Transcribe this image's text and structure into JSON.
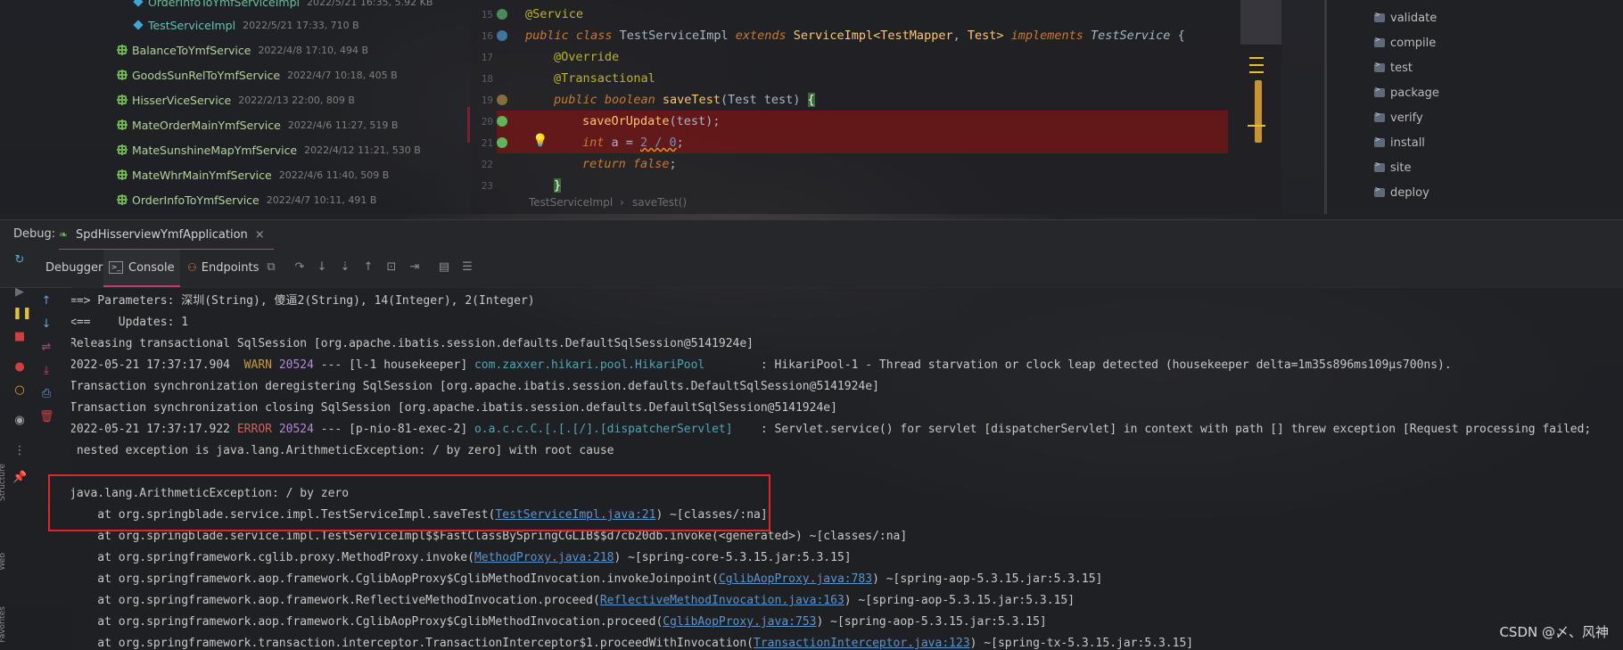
{
  "tree": {
    "rows": [
      {
        "name": "OrderInfoToYmfServiceImpl",
        "meta": "2022/5/21 16:35, 5.92 KB",
        "icon": "class-icon"
      },
      {
        "name": "TestServiceImpl",
        "meta": "2022/5/21 17:33, 710 B",
        "icon": "class-icon"
      },
      {
        "name": "BalanceToYmfService",
        "meta": "2022/4/8 17:10, 494 B",
        "icon": "interface-icon"
      },
      {
        "name": "GoodsSunRelToYmfService",
        "meta": "2022/4/7 10:18, 405 B",
        "icon": "interface-icon"
      },
      {
        "name": "HisserViceService",
        "meta": "2022/2/13 22:00, 809 B",
        "icon": "interface-icon"
      },
      {
        "name": "MateOrderMainYmfService",
        "meta": "2022/4/6 11:27, 519 B",
        "icon": "interface-icon"
      },
      {
        "name": "MateSunshineMapYmfService",
        "meta": "2022/4/12 11:21, 530 B",
        "icon": "interface-icon"
      },
      {
        "name": "MateWhrMainYmfService",
        "meta": "2022/4/6 11:40, 509 B",
        "icon": "interface-icon"
      },
      {
        "name": "OrderInfoToYmfService",
        "meta": "2022/4/7 10:11, 491 B",
        "icon": "interface-icon"
      }
    ]
  },
  "editor": {
    "line_numbers": [
      "15",
      "16",
      "17",
      "18",
      "19",
      "20",
      "21",
      "22",
      "23"
    ],
    "lines": {
      "l15_ann": "@Service",
      "l16_kw1": "public class ",
      "l16_cls": "TestServiceImpl ",
      "l16_kw2": "extends ",
      "l16_sup": "ServiceImpl<",
      "l16_t1": "TestMapper",
      "l16_sep": ", ",
      "l16_t2": "Test",
      "l16_close": "> ",
      "l16_kw3": "implements ",
      "l16_ifc": "TestService",
      "l16_brace": " {",
      "l17": "@Override",
      "l18": "@Transactional",
      "l19_kw": "public boolean ",
      "l19_fn": "saveTest",
      "l19_args": "(Test test) ",
      "l19_brace": "{",
      "l20_fn": "saveOrUpdate",
      "l20_rest": "(test);",
      "l21_kw": "int ",
      "l21_a": "a = ",
      "l21_expr": "2 / 0",
      "l21_end": ";",
      "l22_kw": "return false",
      "l22_end": ";",
      "l23": "}"
    },
    "breadcrumb": [
      "TestServiceImpl",
      "›",
      "saveTest()"
    ]
  },
  "maven": {
    "items": [
      "validate",
      "compile",
      "test",
      "package",
      "verify",
      "install",
      "site",
      "deploy"
    ]
  },
  "debug": {
    "label": "Debug:",
    "session_tab": "SpdHisserviewYmfApplication",
    "close": "×",
    "tabs": [
      "Debugger",
      "Console",
      "Endpoints"
    ]
  },
  "console": {
    "l1": "==> Parameters: 深圳(String), 傻逼2(String), 14(Integer), 2(Integer)",
    "l2": "<==    Updates: 1",
    "l3": "Releasing transactional SqlSession [org.apache.ibatis.session.defaults.DefaultSqlSession@5141924e]",
    "l4_ts": "2022-05-21 17:37:17.904  ",
    "l4_lvl": "WARN ",
    "l4_pid": "20524",
    "l4_mid": " --- [l-1 housekeeper] ",
    "l4_logger": "com.zaxxer.hikari.pool.HikariPool       ",
    "l4_msg": " : HikariPool-1 - Thread starvation or clock leap detected (housekeeper delta=1m35s896ms109µs700ns).",
    "l5": "Transaction synchronization deregistering SqlSession [org.apache.ibatis.session.defaults.DefaultSqlSession@5141924e]",
    "l6": "Transaction synchronization closing SqlSession [org.apache.ibatis.session.defaults.DefaultSqlSession@5141924e]",
    "l7_ts": "2022-05-21 17:37:17.922 ",
    "l7_lvl": "ERROR ",
    "l7_pid": "20524",
    "l7_mid": " --- [p-nio-81-exec-2] ",
    "l7_logger": "o.a.c.c.C.[.[.[/].[dispatcherServlet]   ",
    "l7_msg": " : Servlet.service() for servlet [dispatcherServlet] in context with path [] threw exception [Request processing failed;",
    "l8": " nested exception is java.lang.ArithmeticException: / by zero] with root cause",
    "l10": "java.lang.ArithmeticException: / by zero",
    "l11_pre": "    at org.springblade.service.impl.TestServiceImpl.saveTest(",
    "l11_link": "TestServiceImpl.java:21",
    "l11_post": ") ~[classes/:na]",
    "l12": "    at org.springblade.service.impl.TestServiceImpl$$FastClassBySpringCGLIB$$d7cb20db.invoke(<generated>) ~[classes/:na]",
    "l13_pre": "    at org.springframework.cglib.proxy.MethodProxy.invoke(",
    "l13_link": "MethodProxy.java:218",
    "l13_post": ") ~[spring-core-5.3.15.jar:5.3.15]",
    "l14_pre": "    at org.springframework.aop.framework.CglibAopProxy$CglibMethodInvocation.invokeJoinpoint(",
    "l14_link": "CglibAopProxy.java:783",
    "l14_post": ") ~[spring-aop-5.3.15.jar:5.3.15]",
    "l15_pre": "    at org.springframework.aop.framework.ReflectiveMethodInvocation.proceed(",
    "l15_link": "ReflectiveMethodInvocation.java:163",
    "l15_post": ") ~[spring-aop-5.3.15.jar:5.3.15]",
    "l16_pre": "    at org.springframework.aop.framework.CglibAopProxy$CglibMethodInvocation.proceed(",
    "l16_link": "CglibAopProxy.java:753",
    "l16_post": ") ~[spring-aop-5.3.15.jar:5.3.15]",
    "l17_pre": "    at org.springframework.transaction.interceptor.TransactionInterceptor$1.proceedWithInvocation(",
    "l17_link": "TransactionInterceptor.java:123",
    "l17_post": ") ~[spring-tx-5.3.15.jar:5.3.15]"
  },
  "side_labels": [
    "Structure",
    "Web",
    "Favorites"
  ],
  "watermark": "CSDN @〆、风神",
  "colors": {
    "accent": "#c53a6e",
    "error_bg": "#781414",
    "highlight_box": "#e0262b"
  }
}
